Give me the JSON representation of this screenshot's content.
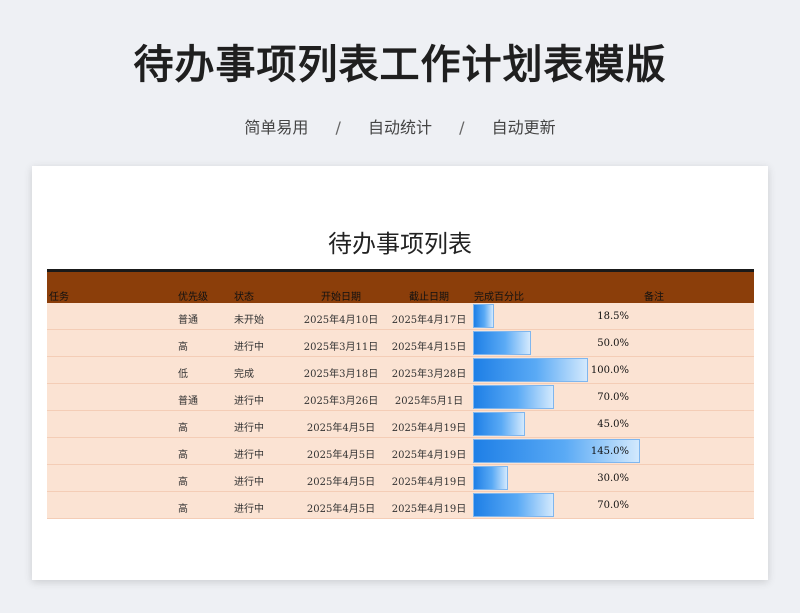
{
  "header": {
    "title": "待办事项列表工作计划表模版",
    "features": [
      "简单易用",
      "自动统计",
      "自动更新"
    ],
    "separator": "/"
  },
  "sheet": {
    "title": "待办事项列表",
    "columns": {
      "task": "任务",
      "priority": "优先级",
      "status": "状态",
      "start": "开始日期",
      "end": "截止日期",
      "percent": "完成百分比",
      "note": "备注"
    },
    "rows": [
      {
        "task": "",
        "priority": "普通",
        "status": "未开始",
        "start": "2025年4月10日",
        "end": "2025年4月17日",
        "percent_label": "18.5%",
        "percent": 18.5,
        "note": ""
      },
      {
        "task": "",
        "priority": "高",
        "status": "进行中",
        "start": "2025年3月11日",
        "end": "2025年4月15日",
        "percent_label": "50.0%",
        "percent": 50.0,
        "note": ""
      },
      {
        "task": "",
        "priority": "低",
        "status": "完成",
        "start": "2025年3月18日",
        "end": "2025年3月28日",
        "percent_label": "100.0%",
        "percent": 100.0,
        "note": ""
      },
      {
        "task": "",
        "priority": "普通",
        "status": "进行中",
        "start": "2025年3月26日",
        "end": "2025年5月1日",
        "percent_label": "70.0%",
        "percent": 70.0,
        "note": ""
      },
      {
        "task": "",
        "priority": "高",
        "status": "进行中",
        "start": "2025年4月5日",
        "end": "2025年4月19日",
        "percent_label": "45.0%",
        "percent": 45.0,
        "note": ""
      },
      {
        "task": "",
        "priority": "高",
        "status": "进行中",
        "start": "2025年4月5日",
        "end": "2025年4月19日",
        "percent_label": "145.0%",
        "percent": 145.0,
        "note": ""
      },
      {
        "task": "",
        "priority": "高",
        "status": "进行中",
        "start": "2025年4月5日",
        "end": "2025年4月19日",
        "percent_label": "30.0%",
        "percent": 30.0,
        "note": ""
      },
      {
        "task": "",
        "priority": "高",
        "status": "进行中",
        "start": "2025年4月5日",
        "end": "2025年4月19日",
        "percent_label": "70.0%",
        "percent": 70.0,
        "note": ""
      }
    ],
    "colors": {
      "header_bg": "#8b3e0a",
      "row_bg": "#fbe3d3",
      "bar_start": "#1e7fe6",
      "bar_end": "#d3e9fd"
    }
  }
}
